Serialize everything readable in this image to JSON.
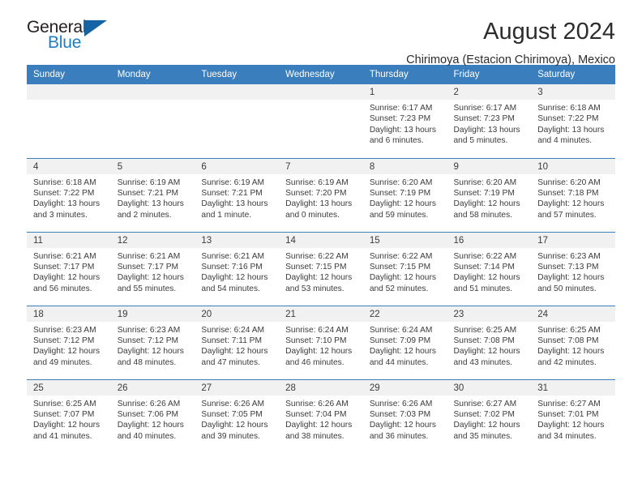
{
  "brand": {
    "name_part1": "General",
    "name_part2": "Blue",
    "accent_color": "#1464a5",
    "blue_text_color": "#1f7fc4"
  },
  "header": {
    "title": "August 2024",
    "subtitle": "Chirimoya (Estacion Chirimoya), Mexico"
  },
  "calendar": {
    "header_bg": "#3a7ebd",
    "daynum_bg": "#f1f1f1",
    "weekdays": [
      "Sunday",
      "Monday",
      "Tuesday",
      "Wednesday",
      "Thursday",
      "Friday",
      "Saturday"
    ],
    "weeks": [
      [
        {
          "day": "",
          "sunrise": "",
          "sunset": "",
          "daylight1": "",
          "daylight2": ""
        },
        {
          "day": "",
          "sunrise": "",
          "sunset": "",
          "daylight1": "",
          "daylight2": ""
        },
        {
          "day": "",
          "sunrise": "",
          "sunset": "",
          "daylight1": "",
          "daylight2": ""
        },
        {
          "day": "",
          "sunrise": "",
          "sunset": "",
          "daylight1": "",
          "daylight2": ""
        },
        {
          "day": "1",
          "sunrise": "Sunrise: 6:17 AM",
          "sunset": "Sunset: 7:23 PM",
          "daylight1": "Daylight: 13 hours",
          "daylight2": "and 6 minutes."
        },
        {
          "day": "2",
          "sunrise": "Sunrise: 6:17 AM",
          "sunset": "Sunset: 7:23 PM",
          "daylight1": "Daylight: 13 hours",
          "daylight2": "and 5 minutes."
        },
        {
          "day": "3",
          "sunrise": "Sunrise: 6:18 AM",
          "sunset": "Sunset: 7:22 PM",
          "daylight1": "Daylight: 13 hours",
          "daylight2": "and 4 minutes."
        }
      ],
      [
        {
          "day": "4",
          "sunrise": "Sunrise: 6:18 AM",
          "sunset": "Sunset: 7:22 PM",
          "daylight1": "Daylight: 13 hours",
          "daylight2": "and 3 minutes."
        },
        {
          "day": "5",
          "sunrise": "Sunrise: 6:19 AM",
          "sunset": "Sunset: 7:21 PM",
          "daylight1": "Daylight: 13 hours",
          "daylight2": "and 2 minutes."
        },
        {
          "day": "6",
          "sunrise": "Sunrise: 6:19 AM",
          "sunset": "Sunset: 7:21 PM",
          "daylight1": "Daylight: 13 hours",
          "daylight2": "and 1 minute."
        },
        {
          "day": "7",
          "sunrise": "Sunrise: 6:19 AM",
          "sunset": "Sunset: 7:20 PM",
          "daylight1": "Daylight: 13 hours",
          "daylight2": "and 0 minutes."
        },
        {
          "day": "8",
          "sunrise": "Sunrise: 6:20 AM",
          "sunset": "Sunset: 7:19 PM",
          "daylight1": "Daylight: 12 hours",
          "daylight2": "and 59 minutes."
        },
        {
          "day": "9",
          "sunrise": "Sunrise: 6:20 AM",
          "sunset": "Sunset: 7:19 PM",
          "daylight1": "Daylight: 12 hours",
          "daylight2": "and 58 minutes."
        },
        {
          "day": "10",
          "sunrise": "Sunrise: 6:20 AM",
          "sunset": "Sunset: 7:18 PM",
          "daylight1": "Daylight: 12 hours",
          "daylight2": "and 57 minutes."
        }
      ],
      [
        {
          "day": "11",
          "sunrise": "Sunrise: 6:21 AM",
          "sunset": "Sunset: 7:17 PM",
          "daylight1": "Daylight: 12 hours",
          "daylight2": "and 56 minutes."
        },
        {
          "day": "12",
          "sunrise": "Sunrise: 6:21 AM",
          "sunset": "Sunset: 7:17 PM",
          "daylight1": "Daylight: 12 hours",
          "daylight2": "and 55 minutes."
        },
        {
          "day": "13",
          "sunrise": "Sunrise: 6:21 AM",
          "sunset": "Sunset: 7:16 PM",
          "daylight1": "Daylight: 12 hours",
          "daylight2": "and 54 minutes."
        },
        {
          "day": "14",
          "sunrise": "Sunrise: 6:22 AM",
          "sunset": "Sunset: 7:15 PM",
          "daylight1": "Daylight: 12 hours",
          "daylight2": "and 53 minutes."
        },
        {
          "day": "15",
          "sunrise": "Sunrise: 6:22 AM",
          "sunset": "Sunset: 7:15 PM",
          "daylight1": "Daylight: 12 hours",
          "daylight2": "and 52 minutes."
        },
        {
          "day": "16",
          "sunrise": "Sunrise: 6:22 AM",
          "sunset": "Sunset: 7:14 PM",
          "daylight1": "Daylight: 12 hours",
          "daylight2": "and 51 minutes."
        },
        {
          "day": "17",
          "sunrise": "Sunrise: 6:23 AM",
          "sunset": "Sunset: 7:13 PM",
          "daylight1": "Daylight: 12 hours",
          "daylight2": "and 50 minutes."
        }
      ],
      [
        {
          "day": "18",
          "sunrise": "Sunrise: 6:23 AM",
          "sunset": "Sunset: 7:12 PM",
          "daylight1": "Daylight: 12 hours",
          "daylight2": "and 49 minutes."
        },
        {
          "day": "19",
          "sunrise": "Sunrise: 6:23 AM",
          "sunset": "Sunset: 7:12 PM",
          "daylight1": "Daylight: 12 hours",
          "daylight2": "and 48 minutes."
        },
        {
          "day": "20",
          "sunrise": "Sunrise: 6:24 AM",
          "sunset": "Sunset: 7:11 PM",
          "daylight1": "Daylight: 12 hours",
          "daylight2": "and 47 minutes."
        },
        {
          "day": "21",
          "sunrise": "Sunrise: 6:24 AM",
          "sunset": "Sunset: 7:10 PM",
          "daylight1": "Daylight: 12 hours",
          "daylight2": "and 46 minutes."
        },
        {
          "day": "22",
          "sunrise": "Sunrise: 6:24 AM",
          "sunset": "Sunset: 7:09 PM",
          "daylight1": "Daylight: 12 hours",
          "daylight2": "and 44 minutes."
        },
        {
          "day": "23",
          "sunrise": "Sunrise: 6:25 AM",
          "sunset": "Sunset: 7:08 PM",
          "daylight1": "Daylight: 12 hours",
          "daylight2": "and 43 minutes."
        },
        {
          "day": "24",
          "sunrise": "Sunrise: 6:25 AM",
          "sunset": "Sunset: 7:08 PM",
          "daylight1": "Daylight: 12 hours",
          "daylight2": "and 42 minutes."
        }
      ],
      [
        {
          "day": "25",
          "sunrise": "Sunrise: 6:25 AM",
          "sunset": "Sunset: 7:07 PM",
          "daylight1": "Daylight: 12 hours",
          "daylight2": "and 41 minutes."
        },
        {
          "day": "26",
          "sunrise": "Sunrise: 6:26 AM",
          "sunset": "Sunset: 7:06 PM",
          "daylight1": "Daylight: 12 hours",
          "daylight2": "and 40 minutes."
        },
        {
          "day": "27",
          "sunrise": "Sunrise: 6:26 AM",
          "sunset": "Sunset: 7:05 PM",
          "daylight1": "Daylight: 12 hours",
          "daylight2": "and 39 minutes."
        },
        {
          "day": "28",
          "sunrise": "Sunrise: 6:26 AM",
          "sunset": "Sunset: 7:04 PM",
          "daylight1": "Daylight: 12 hours",
          "daylight2": "and 38 minutes."
        },
        {
          "day": "29",
          "sunrise": "Sunrise: 6:26 AM",
          "sunset": "Sunset: 7:03 PM",
          "daylight1": "Daylight: 12 hours",
          "daylight2": "and 36 minutes."
        },
        {
          "day": "30",
          "sunrise": "Sunrise: 6:27 AM",
          "sunset": "Sunset: 7:02 PM",
          "daylight1": "Daylight: 12 hours",
          "daylight2": "and 35 minutes."
        },
        {
          "day": "31",
          "sunrise": "Sunrise: 6:27 AM",
          "sunset": "Sunset: 7:01 PM",
          "daylight1": "Daylight: 12 hours",
          "daylight2": "and 34 minutes."
        }
      ]
    ]
  }
}
